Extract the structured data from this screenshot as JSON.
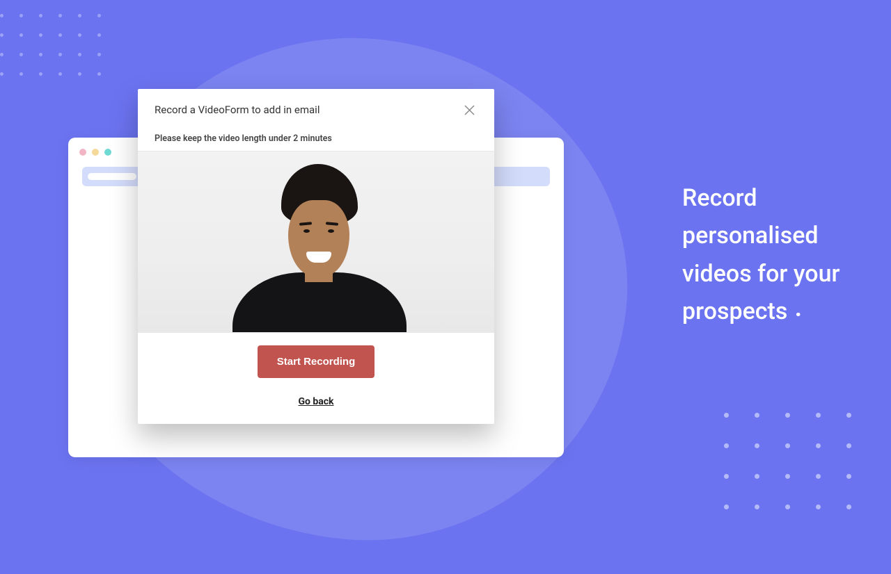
{
  "hero": {
    "text": "Record personalised videos for your prospects"
  },
  "modal": {
    "title": "Record a VideoForm to add in email",
    "subtitle": "Please keep the video length under 2 minutes",
    "start_label": "Start Recording",
    "back_label": "Go back"
  },
  "colors": {
    "background": "#6b73f0",
    "accent": "#c25450"
  }
}
